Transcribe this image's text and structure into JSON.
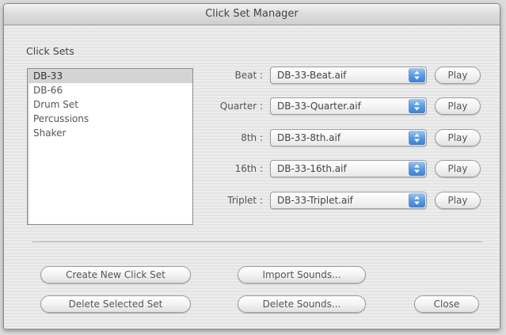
{
  "window": {
    "title": "Click Set Manager"
  },
  "click_sets": {
    "label": "Click Sets",
    "items": [
      {
        "label": "DB-33",
        "selected": true
      },
      {
        "label": "DB-66",
        "selected": false
      },
      {
        "label": "Drum Set",
        "selected": false
      },
      {
        "label": "Percussions",
        "selected": false
      },
      {
        "label": "Shaker",
        "selected": false
      }
    ]
  },
  "sounds": [
    {
      "label": "Beat :",
      "file": "DB-33-Beat.aif",
      "play": "Play"
    },
    {
      "label": "Quarter :",
      "file": "DB-33-Quarter.aif",
      "play": "Play"
    },
    {
      "label": "8th :",
      "file": "DB-33-8th.aif",
      "play": "Play"
    },
    {
      "label": "16th :",
      "file": "DB-33-16th.aif",
      "play": "Play"
    },
    {
      "label": "Triplet :",
      "file": "DB-33-Triplet.aif",
      "play": "Play"
    }
  ],
  "buttons": {
    "create_new": "Create New Click Set",
    "delete_selected": "Delete Selected Set",
    "import_sounds": "Import Sounds...",
    "delete_sounds": "Delete Sounds...",
    "close": "Close"
  },
  "colors": {
    "popup_arrow_accent": "#5b9ae3",
    "selection": "#d4d4d4"
  }
}
